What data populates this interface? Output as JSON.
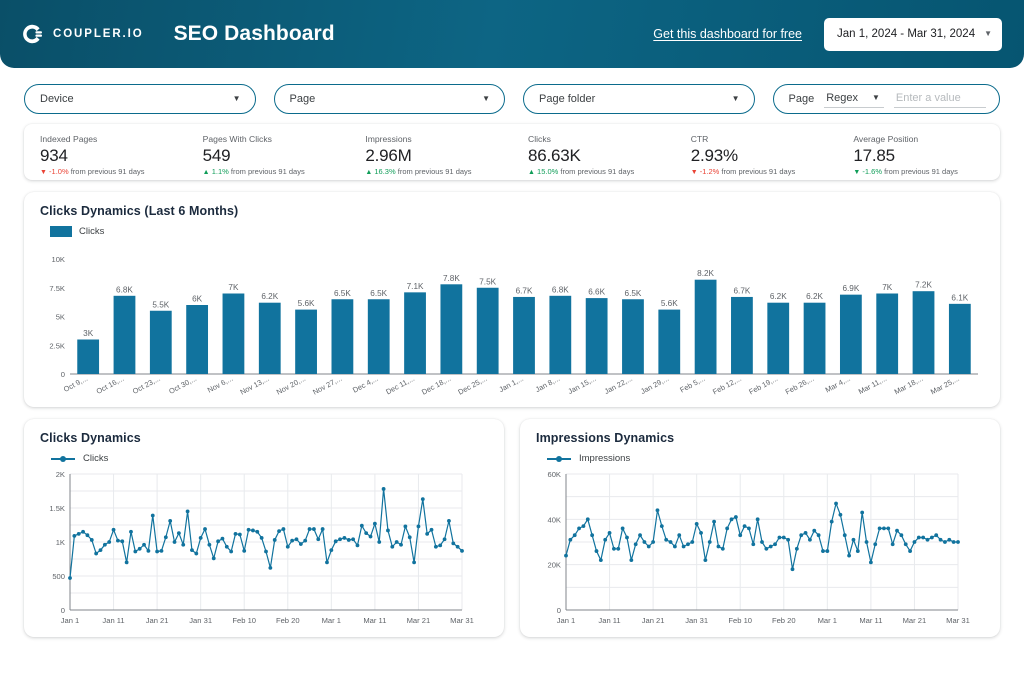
{
  "header": {
    "brand_name": "COUPLER.IO",
    "logo_icon": "coupler-logo-icon",
    "title": "SEO Dashboard",
    "cta_link": "Get this dashboard for free",
    "date_range": "Jan 1, 2024 - Mar 31, 2024",
    "dropdown_icon": "chevron-down-icon"
  },
  "filters": [
    {
      "label": "Device",
      "icon": "chevron-down-icon"
    },
    {
      "label": "Page",
      "icon": "chevron-down-icon"
    },
    {
      "label": "Page folder",
      "icon": "chevron-down-icon"
    }
  ],
  "regex_filter": {
    "field_label": "Page",
    "match_type": "Regex",
    "value": "",
    "placeholder": "Enter a value",
    "icon": "chevron-down-icon"
  },
  "kpis": [
    {
      "label": "Indexed Pages",
      "value": "934",
      "direction": "down",
      "change": "-1.0%",
      "change_tone": "neg",
      "suffix": "from previous 91 days"
    },
    {
      "label": "Pages With Clicks",
      "value": "549",
      "direction": "up",
      "change": "1.1%",
      "change_tone": "pos",
      "suffix": "from previous 91 days"
    },
    {
      "label": "Impressions",
      "value": "2.96M",
      "direction": "up",
      "change": "16.3%",
      "change_tone": "pos",
      "suffix": "from previous 91 days"
    },
    {
      "label": "Clicks",
      "value": "86.63K",
      "direction": "up",
      "change": "15.0%",
      "change_tone": "pos",
      "suffix": "from previous 91 days"
    },
    {
      "label": "CTR",
      "value": "2.93%",
      "direction": "down",
      "change": "-1.2%",
      "change_tone": "neg",
      "suffix": "from previous 91 days"
    },
    {
      "label": "Average Position",
      "value": "17.85",
      "direction": "down-good",
      "change": "-1.6%",
      "change_tone": "pos",
      "suffix": "from previous 91 days"
    }
  ],
  "colors": {
    "series_blue": "#11739e",
    "header_dark": "#0a4f68",
    "header_light": "#0d6584",
    "positive": "#0f9d58",
    "negative": "#ea4335",
    "grid": "#e8eaed"
  },
  "chart_data": [
    {
      "id": "clicks_weekly_bar",
      "type": "bar",
      "title": "Clicks Dynamics (Last 6 Months)",
      "legend": [
        "Clicks"
      ],
      "legend_position": "top-left",
      "xlabel": "",
      "ylabel": "",
      "ylim": [
        0,
        10000
      ],
      "yticks": [
        "0",
        "2.5K",
        "5K",
        "7.5K",
        "10K"
      ],
      "ytick_values": [
        0,
        2500,
        5000,
        7500,
        10000
      ],
      "grid": false,
      "categories": [
        "Oct 9,...",
        "Oct 16,...",
        "Oct 23,...",
        "Oct 30,...",
        "Nov 6,...",
        "Nov 13,...",
        "Nov 20,...",
        "Nov 27,...",
        "Dec 4,...",
        "Dec 11,...",
        "Dec 18,...",
        "Dec 25,...",
        "Jan 1,...",
        "Jan 8,...",
        "Jan 15,...",
        "Jan 22,...",
        "Jan 29,...",
        "Feb 5,...",
        "Feb 12,...",
        "Feb 19,...",
        "Feb 26,...",
        "Mar 4,...",
        "Mar 11,...",
        "Mar 18,...",
        "Mar 25,..."
      ],
      "values": [
        3000,
        6800,
        5500,
        6000,
        7000,
        6200,
        5600,
        6500,
        6500,
        7100,
        7800,
        7500,
        6700,
        6800,
        6600,
        6500,
        5600,
        8200,
        6700,
        6200,
        6200,
        6900,
        7000,
        7200,
        6100
      ],
      "data_labels": [
        "3K",
        "6.8K",
        "5.5K",
        "6K",
        "7K",
        "6.2K",
        "5.6K",
        "6.5K",
        "6.5K",
        "7.1K",
        "7.8K",
        "7.5K",
        "6.7K",
        "6.8K",
        "6.6K",
        "6.5K",
        "5.6K",
        "8.2K",
        "6.7K",
        "6.2K",
        "6.2K",
        "6.9K",
        "7K",
        "7.2K",
        "6.1K"
      ]
    },
    {
      "id": "clicks_daily_line",
      "type": "line",
      "title": "Clicks Dynamics",
      "legend": [
        "Clicks"
      ],
      "legend_position": "top-left",
      "xlabel": "",
      "ylabel": "",
      "ylim": [
        0,
        2000
      ],
      "yticks": [
        "0",
        "500",
        "1K",
        "1.5K",
        "2K"
      ],
      "ytick_values": [
        0,
        500,
        1000,
        1500,
        2000
      ],
      "xticks": [
        "Jan 1",
        "Jan 11",
        "Jan 21",
        "Jan 31",
        "Feb 10",
        "Feb 20",
        "Mar 1",
        "Mar 11",
        "Mar 21",
        "Mar 31"
      ],
      "grid": true,
      "values": [
        470,
        1090,
        1120,
        1150,
        1100,
        1030,
        830,
        880,
        960,
        1000,
        1180,
        1020,
        1010,
        700,
        1150,
        860,
        900,
        960,
        870,
        1390,
        860,
        870,
        1070,
        1310,
        1000,
        1130,
        960,
        1450,
        880,
        830,
        1060,
        1190,
        960,
        760,
        1010,
        1050,
        930,
        860,
        1120,
        1110,
        870,
        1180,
        1170,
        1150,
        1060,
        860,
        620,
        1030,
        1160,
        1190,
        930,
        1020,
        1040,
        970,
        1020,
        1190,
        1190,
        1040,
        1190,
        700,
        880,
        1010,
        1040,
        1060,
        1030,
        1040,
        950,
        1240,
        1130,
        1080,
        1270,
        1000,
        1780,
        1170,
        930,
        1000,
        960,
        1230,
        1070,
        700,
        1230,
        1630,
        1120,
        1180,
        930,
        950,
        1040,
        1310,
        980,
        930,
        870
      ]
    },
    {
      "id": "impressions_daily_line",
      "type": "line",
      "title": "Impressions Dynamics",
      "legend": [
        "Impressions"
      ],
      "legend_position": "top-left",
      "xlabel": "",
      "ylabel": "",
      "ylim": [
        0,
        60000
      ],
      "yticks": [
        "0",
        "20K",
        "40K",
        "60K"
      ],
      "ytick_values": [
        0,
        20000,
        40000,
        60000
      ],
      "xticks": [
        "Jan 1",
        "Jan 11",
        "Jan 21",
        "Jan 31",
        "Feb 10",
        "Feb 20",
        "Mar 1",
        "Mar 11",
        "Mar 21",
        "Mar 31"
      ],
      "grid": true,
      "values": [
        24000,
        31000,
        33000,
        36000,
        37000,
        40000,
        33000,
        26000,
        22000,
        31000,
        34000,
        27000,
        27000,
        36000,
        32000,
        22000,
        29000,
        33000,
        30000,
        28000,
        30000,
        44000,
        37000,
        31000,
        30000,
        28000,
        33000,
        28000,
        29000,
        30000,
        38000,
        34000,
        22000,
        30000,
        39000,
        28000,
        27000,
        36000,
        40000,
        41000,
        33000,
        37000,
        36000,
        29000,
        40000,
        30000,
        27000,
        28000,
        29000,
        32000,
        32000,
        31000,
        18000,
        27000,
        33000,
        34000,
        31000,
        35000,
        33000,
        26000,
        26000,
        39000,
        47000,
        42000,
        33000,
        24000,
        31000,
        26000,
        43000,
        30000,
        21000,
        29000,
        36000,
        36000,
        36000,
        29000,
        35000,
        33000,
        29000,
        26000,
        30000,
        32000,
        32000,
        31000,
        32000,
        33000,
        31000,
        30000,
        31000,
        30000,
        30000
      ]
    }
  ]
}
